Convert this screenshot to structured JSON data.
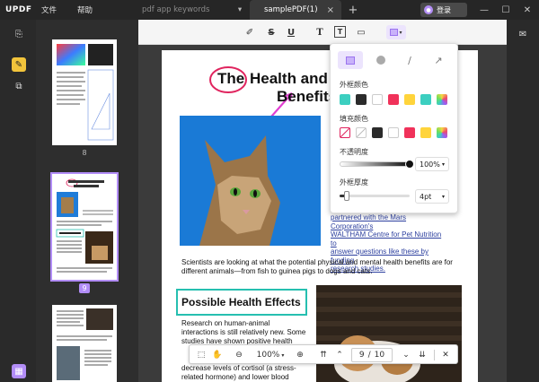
{
  "titlebar": {
    "logo_main": "UPDF",
    "menu": [
      "文件",
      "帮助"
    ],
    "tabs": [
      {
        "label": "pdf app keywords"
      },
      {
        "label": "samplePDF(1)"
      }
    ],
    "login_label": "登录"
  },
  "thumbnails": [
    {
      "number": "8"
    },
    {
      "number": "9"
    }
  ],
  "page": {
    "title_word": "The",
    "title_rest": "Health and M",
    "title_line2": "Benefits o",
    "right_block": "partnered with the Mars Corporation's\nWALTHAM Centre for Pet Nutrition to\nanswer questions like these by funding\nresearch studies.",
    "paragraph1": "Scientists are looking at what the potential physical and mental health benefits are for different animals—from fish to guinea pigs to dogs and cats.",
    "section_heading": "Possible Health Effects",
    "paragraph2": "Research on human-animal interactions is still relatively new. Some studies have shown positive health effects, but the results have been mixed.",
    "paragraph3": "decrease levels of cortisol (a stress-related hormone) and lower blood pressure. Other"
  },
  "popup": {
    "border_color_label": "外框颜色",
    "fill_color_label": "填充颜色",
    "opacity_label": "不透明度",
    "opacity_value": "100%",
    "opacity_level": 1.0,
    "thickness_label": "外框厚度",
    "thickness_value": "4pt",
    "thickness_level": 0.1,
    "border_colors": [
      "#3ccfc0",
      "#2b2b2b",
      "#ffffff",
      "#f0325a",
      "#ffd43b",
      "#3ccfc0",
      "gradient"
    ],
    "fill_colors": [
      "none",
      "transparent",
      "#2b2b2b",
      "#ffffff",
      "#f0325a",
      "#ffd43b",
      "gradient"
    ]
  },
  "bottombar": {
    "zoom": "100%",
    "page_current": "9",
    "page_separator": "/",
    "page_total": "10"
  },
  "colors": {
    "accent": "#b28df7",
    "annotation_red": "#e0245e",
    "annotation_magenta": "#e23fd2",
    "annotation_teal": "#26bfb0"
  }
}
